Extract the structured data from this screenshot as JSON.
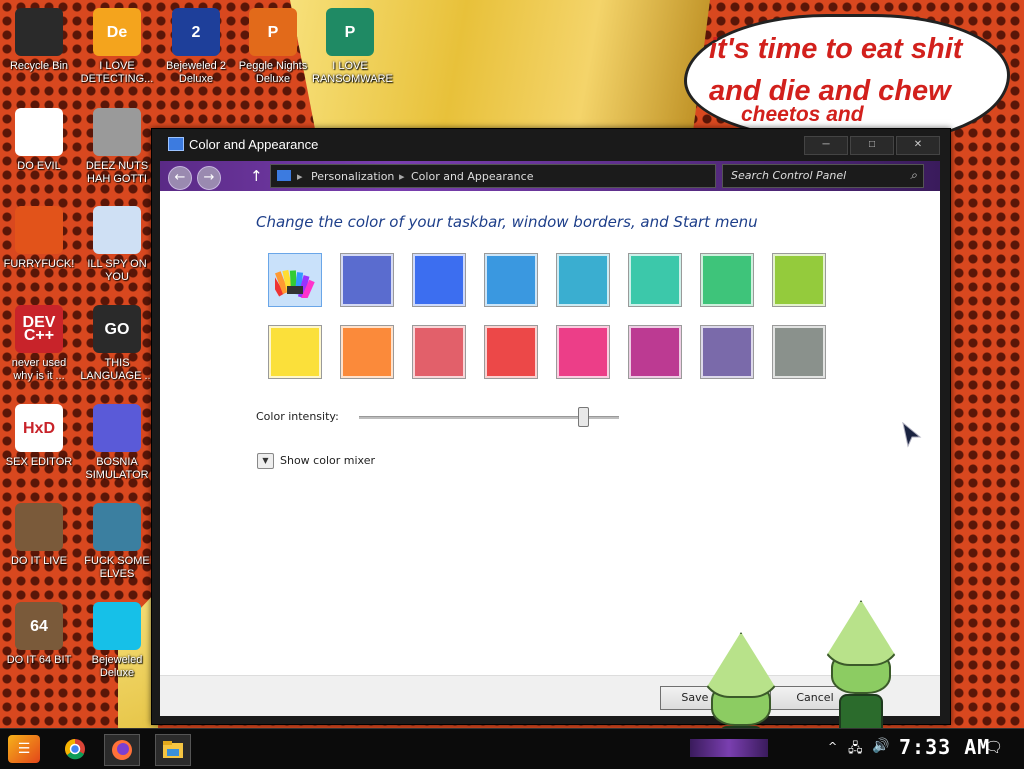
{
  "desktop": {
    "speech_bubble": [
      "it's time to eat shit",
      "and die and chew",
      "cheetos and"
    ],
    "icons": [
      {
        "label": "Recycle Bin",
        "glyph": "",
        "color": "#2a2a2a"
      },
      {
        "label": "I LOVE DETECTING...",
        "glyph": "De",
        "color": "#f4a41d"
      },
      {
        "label": "Bejeweled 2 Deluxe",
        "glyph": "2",
        "color": "#1e3f9a"
      },
      {
        "label": "Peggle Nights Deluxe",
        "glyph": "P",
        "color": "#e26a1a"
      },
      {
        "label": "I LOVE RANSOMWARE",
        "glyph": "P",
        "color": "#1f8a64"
      },
      {
        "label": "DO EVIL",
        "glyph": "",
        "color": "#ffffff"
      },
      {
        "label": "DEEZ NUTS HAH GOTTI",
        "glyph": "",
        "color": "#9a9a9a"
      },
      {
        "label": "FURRYFUCK!",
        "glyph": "",
        "color": "#e2531a"
      },
      {
        "label": "ILL SPY ON YOU",
        "glyph": "",
        "color": "#cfe0f4"
      },
      {
        "label": "never used why is it ...",
        "glyph": "DEV C++",
        "color": "#c8232a"
      },
      {
        "label": "THIS LANGUAGE ...",
        "glyph": "GO",
        "color": "#2a2a2a"
      },
      {
        "label": "SEX EDITOR",
        "glyph": "HxD",
        "color": "#ffffff"
      },
      {
        "label": "BOSNIA SIMULATOR",
        "glyph": "",
        "color": "#5a5ad8"
      },
      {
        "label": "DO IT LIVE",
        "glyph": "",
        "color": "#7a5a3a"
      },
      {
        "label": "FUCK SOME ELVES",
        "glyph": "",
        "color": "#3b7fa0"
      },
      {
        "label": "DO IT 64 BIT",
        "glyph": "64",
        "color": "#7a5a3a"
      },
      {
        "label": "Bejeweled Deluxe",
        "glyph": "",
        "color": "#16c0e8"
      }
    ]
  },
  "window": {
    "title": "Color and Appearance",
    "controls": {
      "minimize": "─",
      "maximize": "□",
      "close": "✕"
    },
    "breadcrumb": [
      "Personalization",
      "Color and Appearance"
    ],
    "search_placeholder": "Search Control Panel",
    "heading": "Change the color of your taskbar, window borders, and Start menu",
    "swatches_row1": [
      "custom",
      "#5a6ccf",
      "#3c6ef0",
      "#3a98e0",
      "#3aaed0",
      "#3cc8aa",
      "#3ec47a",
      "#94cb3c"
    ],
    "swatches_row2": [
      "#fbe03a",
      "#fb8a3a",
      "#e2606a",
      "#ec4848",
      "#ec3e88",
      "#bc3a92",
      "#7a6aaa",
      "#8a918c"
    ],
    "selected_swatch": 0,
    "intensity_label": "Color intensity:",
    "intensity_value": 0.86,
    "mixer_label": "Show color mixer",
    "save_label": "Save chan",
    "cancel_label": "Cancel"
  },
  "taskbar": {
    "clock": "7:33 AM",
    "apps": [
      "chrome",
      "firefox",
      "explorer"
    ]
  }
}
